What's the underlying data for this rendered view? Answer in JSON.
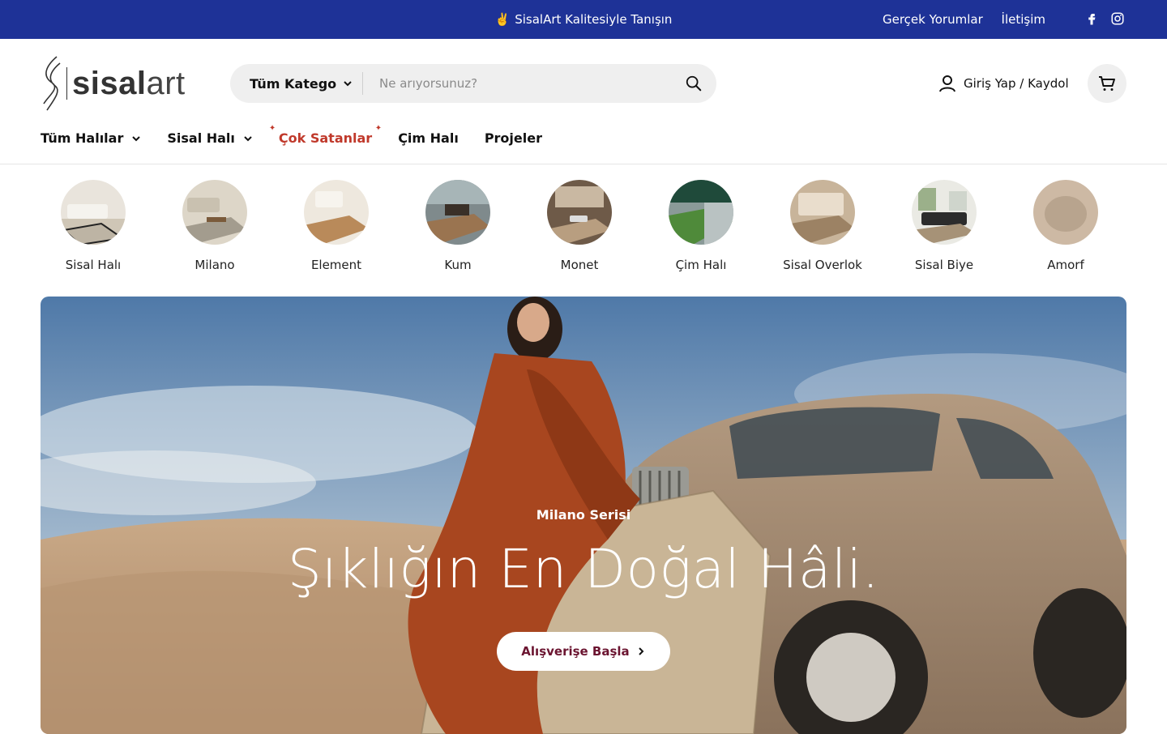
{
  "topbar": {
    "announcement_emoji": "✌️",
    "announcement": "SisalArt Kalitesiyle Tanışın",
    "links": [
      "Gerçek Yorumlar",
      "İletişim"
    ],
    "social_icons": [
      "facebook-icon",
      "instagram-icon"
    ],
    "background": "#1e3297"
  },
  "header": {
    "logo": {
      "strong": "sisal",
      "light": "art"
    },
    "search": {
      "category_label": "Tüm Katego",
      "placeholder": "Ne arıyorsunuz?"
    },
    "account_label": "Giriş Yap / Kaydol"
  },
  "nav": {
    "items": [
      {
        "label": "Tüm Halılar",
        "has_dropdown": true
      },
      {
        "label": "Sisal Halı",
        "has_dropdown": true
      },
      {
        "label": "Çok Satanlar",
        "highlight": true
      },
      {
        "label": "Çim Halı"
      },
      {
        "label": "Projeler"
      }
    ],
    "highlight_color": "#c0392b"
  },
  "categories": [
    {
      "label": "Sisal Halı"
    },
    {
      "label": "Milano"
    },
    {
      "label": "Element"
    },
    {
      "label": "Kum"
    },
    {
      "label": "Monet"
    },
    {
      "label": "Çim Halı"
    },
    {
      "label": "Sisal Overlok"
    },
    {
      "label": "Sisal Biye"
    },
    {
      "label": "Amorf"
    }
  ],
  "hero": {
    "eyebrow": "Milano Serisi",
    "title": "Şıklığın En Doğal Hâli.",
    "cta": "Alışverişe Başla",
    "cta_color": "#6b1430"
  }
}
